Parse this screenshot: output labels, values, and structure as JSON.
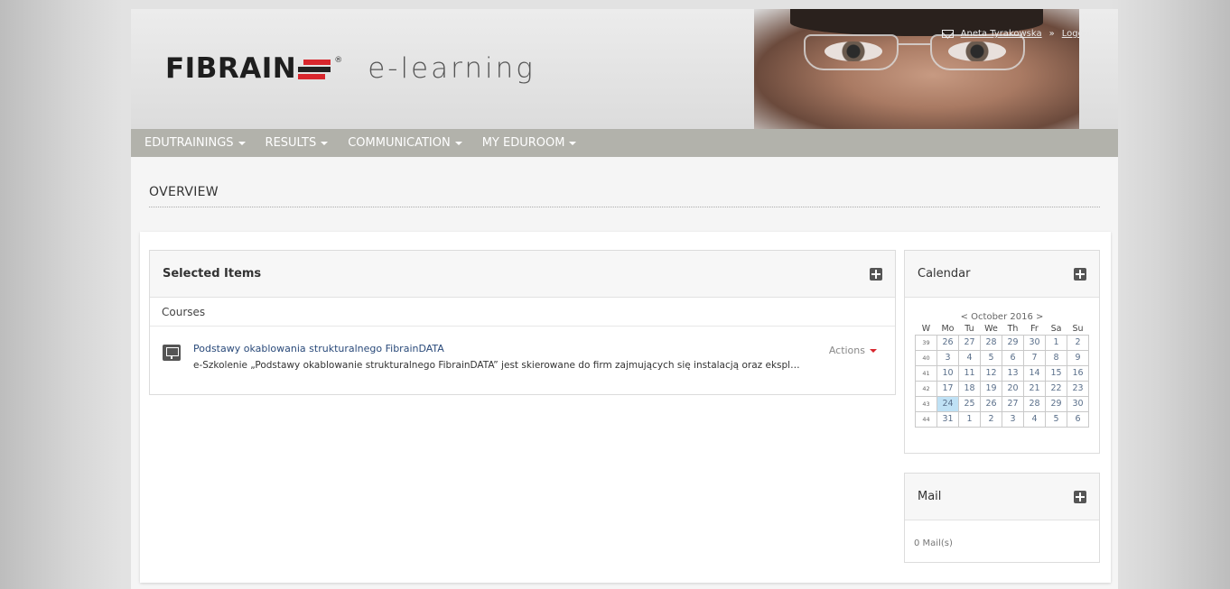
{
  "header": {
    "brand": "FIBRAIN",
    "reg_mark": "®",
    "product": "e-learning",
    "user_name": "Aneta Tyrakowska",
    "separator": "»",
    "logout": "Logout",
    "colors": {
      "brand_red": "#d8262d",
      "nav_bg": "#b2b2ab",
      "link": "#2a4a7a",
      "today": "#bfe1f5"
    }
  },
  "nav": {
    "items": [
      {
        "label": "EDUTRAININGS"
      },
      {
        "label": "RESULTS"
      },
      {
        "label": "COMMUNICATION"
      },
      {
        "label": "MY EDUROOM"
      }
    ]
  },
  "overview": {
    "title": "OVERVIEW"
  },
  "selected_items": {
    "title": "Selected Items",
    "section": "Courses",
    "courses": [
      {
        "title": "Podstawy okablowania strukturalnego FibrainDATA",
        "description": "e-Szkolenie „Podstawy okablowanie strukturalnego FibrainDATA” jest skierowane do firm zajmujących się instalacją oraz ekspl…",
        "actions_label": "Actions"
      }
    ]
  },
  "calendar": {
    "title": "Calendar",
    "prev": "<",
    "month": "October 2016",
    "next": ">",
    "headers": [
      "W",
      "Mo",
      "Tu",
      "We",
      "Th",
      "Fr",
      "Sa",
      "Su"
    ],
    "weeks": [
      {
        "w": "39",
        "days": [
          "26",
          "27",
          "28",
          "29",
          "30",
          "1",
          "2"
        ]
      },
      {
        "w": "40",
        "days": [
          "3",
          "4",
          "5",
          "6",
          "7",
          "8",
          "9"
        ]
      },
      {
        "w": "41",
        "days": [
          "10",
          "11",
          "12",
          "13",
          "14",
          "15",
          "16"
        ]
      },
      {
        "w": "42",
        "days": [
          "17",
          "18",
          "19",
          "20",
          "21",
          "22",
          "23"
        ]
      },
      {
        "w": "43",
        "days": [
          "24",
          "25",
          "26",
          "27",
          "28",
          "29",
          "30"
        ]
      },
      {
        "w": "44",
        "days": [
          "31",
          "1",
          "2",
          "3",
          "4",
          "5",
          "6"
        ]
      }
    ],
    "today": "24"
  },
  "mail": {
    "title": "Mail",
    "count_text": "0 Mail(s)"
  }
}
